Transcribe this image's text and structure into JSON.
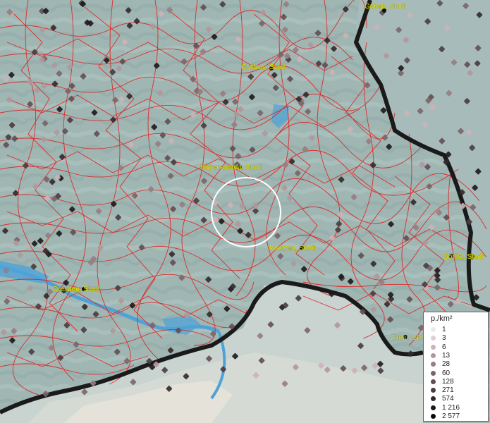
{
  "map": {
    "cities": [
      {
        "name": "Guben, Stadt"
      },
      {
        "name": "Cottbus, Stadt"
      },
      {
        "name": "Hoyerswerda, Stadt"
      },
      {
        "name": "Bautzen, Stadt"
      },
      {
        "name": "Görlitz, Stadt"
      },
      {
        "name": "Dresden, Stadt"
      },
      {
        "name": "Zittau, Stadt"
      }
    ],
    "legend": {
      "title": "p./km²",
      "entries": [
        {
          "label": "1",
          "color": "#f3e6e8"
        },
        {
          "label": "3",
          "color": "#e1cdd0"
        },
        {
          "label": "6",
          "color": "#cdb2b6"
        },
        {
          "label": "13",
          "color": "#b1979b"
        },
        {
          "label": "28",
          "color": "#977c81"
        },
        {
          "label": "60",
          "color": "#7b6468"
        },
        {
          "label": "128",
          "color": "#624e52"
        },
        {
          "label": "271",
          "color": "#4a3b3e"
        },
        {
          "label": "574",
          "color": "#33292b"
        },
        {
          "label": "1 216",
          "color": "#1e1819"
        },
        {
          "label": "2 577",
          "color": "#0a0809"
        }
      ]
    },
    "colors": {
      "land": "#9fb6b3",
      "boundary": "#e1201f",
      "border": "#1a1a1a",
      "water": "#4da3d8",
      "label": "#e6e600"
    }
  }
}
